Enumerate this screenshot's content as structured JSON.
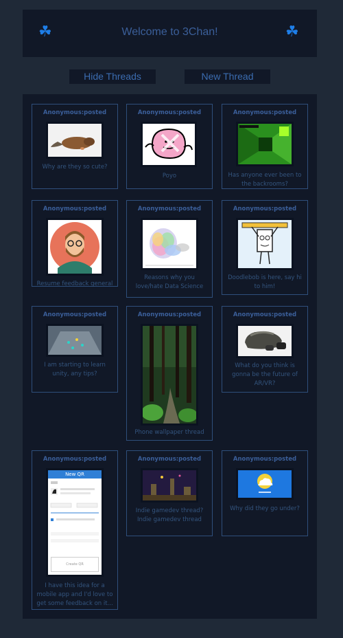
{
  "header": {
    "title": "Welcome to 3Chan!",
    "left_icon": "clover-icon",
    "right_icon": "clover-icon",
    "clover_glyph": "☘",
    "accent": "#1e7ee8"
  },
  "buttons": {
    "hide_label": "Hide Threads",
    "new_label": "New Thread"
  },
  "threads": [
    {
      "poster": "Anonymous:posted",
      "caption": "Why are they so cute?",
      "image": "platypus-photo"
    },
    {
      "poster": "Anonymous:posted",
      "caption": "Poyo",
      "image": "pink-blob-drawing"
    },
    {
      "poster": "Anonymous:posted",
      "caption": "Has anyone ever been to the backrooms?",
      "image": "green-corridor-screenshot"
    },
    {
      "poster": "Anonymous:posted",
      "caption": "Resume feedback general",
      "image": "bearded-man-avatar"
    },
    {
      "poster": "Anonymous:posted",
      "caption": "Reasons why you love/hate Data Science",
      "image": "scatter-plot-image"
    },
    {
      "poster": "Anonymous:posted",
      "caption": "Doodlebob is here, say hi to him!",
      "image": "doodlebob-drawing"
    },
    {
      "poster": "Anonymous:posted",
      "caption": "I am starting to learn unity, any tips?",
      "image": "unity-scene-screenshot"
    },
    {
      "poster": "Anonymous:posted",
      "caption": "Phone wallpaper thread",
      "image": "forest-path-photo"
    },
    {
      "poster": "Anonymous:posted",
      "caption": "What do you think is gonna be the future of AR/VR?",
      "image": "vr-headset-photo"
    },
    {
      "poster": "Anonymous:posted",
      "caption": "I have this idea for a mobile app and I'd love to get some feedback on it...",
      "image": "mobile-app-mockup",
      "mockup": {
        "title": "New QR",
        "create_label": "Create QR"
      }
    },
    {
      "poster": "Anonymous:posted",
      "caption": "Indie gamedev thread? Indie gamedev thread",
      "image": "pixel-game-screenshot"
    },
    {
      "poster": "Anonymous:posted",
      "caption": "Why did they go under?",
      "image": "cloud-logo-image"
    }
  ]
}
